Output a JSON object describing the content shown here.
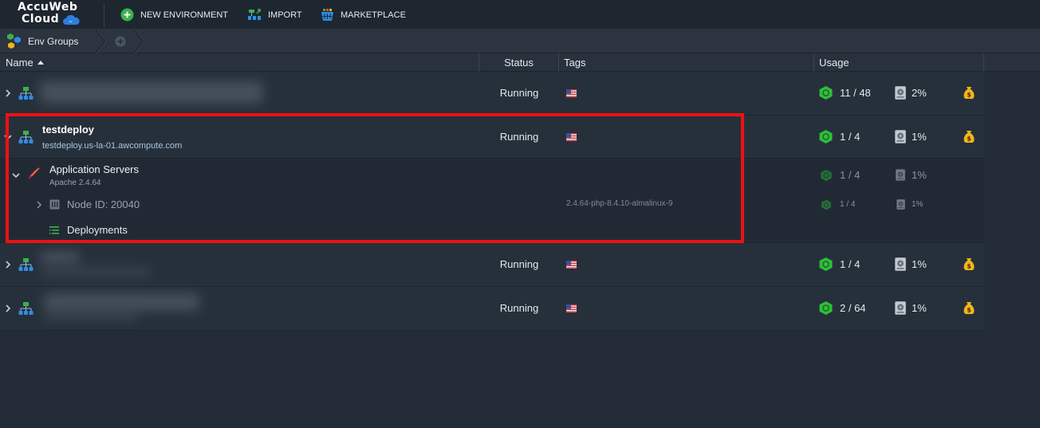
{
  "brand": {
    "line1": "AccuWeb",
    "line2": "Cloud",
    "colors": {
      "accent_blue": "#2f7de1",
      "green": "#36c24a",
      "running_hex": "#2fbe3a",
      "gold": "#f2b61b",
      "highlight": "#ee1111"
    }
  },
  "toolbar": {
    "new_env_label": "NEW ENVIRONMENT",
    "import_label": "IMPORT",
    "marketplace_label": "MARKETPLACE"
  },
  "groups": {
    "label": "Env Groups"
  },
  "columns": {
    "name": "Name",
    "status": "Status",
    "tags": "Tags",
    "usage": "Usage"
  },
  "environments": [
    {
      "name": "",
      "domain": "",
      "status": "Running",
      "cloudlets": "11 / 48",
      "disk": "2%",
      "region_flag": "us-flag"
    },
    {
      "name": "testdeploy",
      "domain": "testdeploy.us-la-01.awcompute.com",
      "status": "Running",
      "cloudlets": "1 / 4",
      "disk": "1%",
      "region_flag": "us-flag"
    },
    {
      "name": "",
      "domain": "",
      "status": "Running",
      "cloudlets": "1 / 4",
      "disk": "1%",
      "region_flag": "us-flag"
    },
    {
      "name": "",
      "domain": "",
      "status": "Running",
      "cloudlets": "2 / 64",
      "disk": "1%",
      "region_flag": "us-flag"
    }
  ],
  "expanded": {
    "layer_name": "Application Servers",
    "layer_version": "Apache 2.4.64",
    "layer_cloudlets": "1 / 4",
    "layer_disk": "1%",
    "node_label": "Node ID: 20040",
    "node_tag": "2.4.64-php-8.4.10-almalinux-9",
    "node_cloudlets": "1 / 4",
    "node_disk": "1%",
    "deployments_label": "Deployments"
  }
}
